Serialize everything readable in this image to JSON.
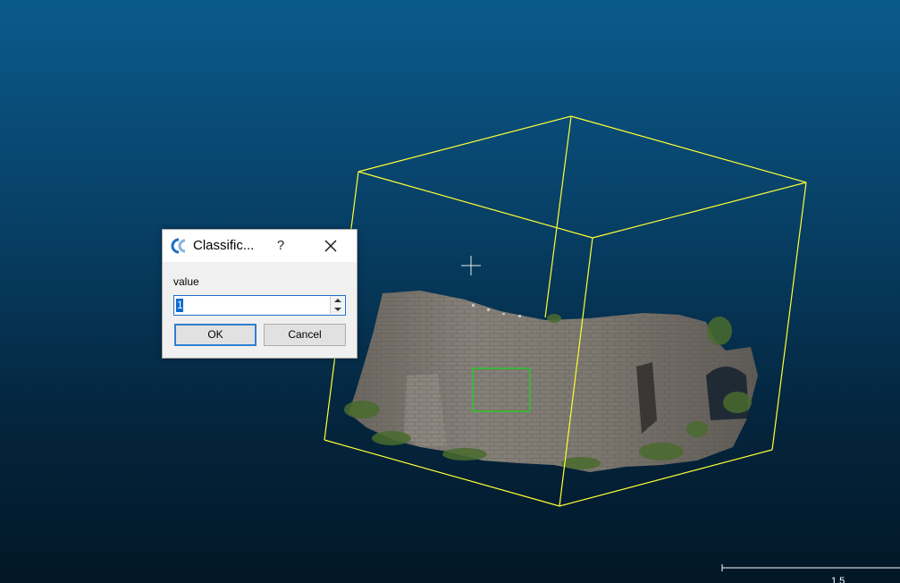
{
  "viewer": {
    "background_top": "#0b5a8c",
    "background_bottom": "#021726",
    "bbox_color": "#ffff33",
    "selection_color": "#22cc22",
    "scale_label": "1.5"
  },
  "dialog": {
    "title": "Classific...",
    "help_label": "?",
    "icon": "cloudcompare-logo-icon",
    "close_icon": "close-icon",
    "field_label": "value",
    "value": "1",
    "ok_label": "OK",
    "cancel_label": "Cancel"
  }
}
